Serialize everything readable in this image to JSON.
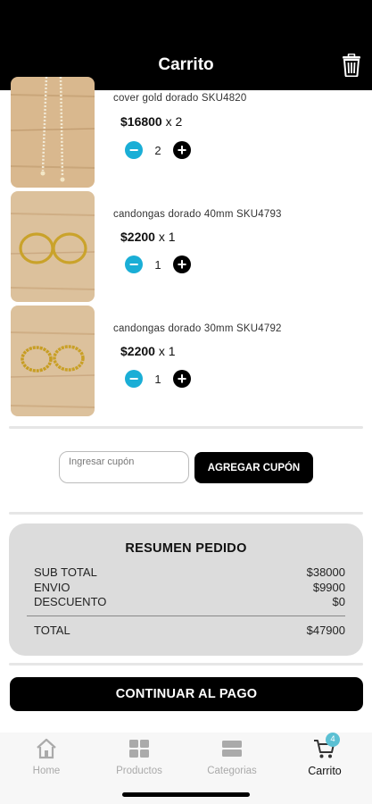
{
  "header": {
    "title": "Carrito",
    "trash_icon": "trash-icon"
  },
  "cart_items": [
    {
      "name": "cover gold dorado   SKU4820",
      "price": "$16800",
      "qty_text": "x 2",
      "quantity": "2"
    },
    {
      "name": "candongas dorado   40mm SKU4793",
      "price": "$2200",
      "qty_text": "x 1",
      "quantity": "1"
    },
    {
      "name": "candongas dorado   30mm SKU4792",
      "price": "$2200",
      "qty_text": "x 1",
      "quantity": "1"
    }
  ],
  "coupon": {
    "placeholder": "Ingresar cupón",
    "button_label": "AGREGAR CUPÓN"
  },
  "summary": {
    "title": "RESUMEN PEDIDO",
    "subtotal_label": "SUB TOTAL",
    "subtotal_value": "$38000",
    "shipping_label": "ENVIO",
    "shipping_value": "$9900",
    "discount_label": "DESCUENTO",
    "discount_value": "$0",
    "total_label": "TOTAL",
    "total_value": "$47900"
  },
  "pay_button": "CONTINUAR AL PAGO",
  "tabs": [
    {
      "label": "Home",
      "icon": "home-icon"
    },
    {
      "label": "Productos",
      "icon": "grid-icon"
    },
    {
      "label": "Categorias",
      "icon": "categories-icon"
    },
    {
      "label": "Carrito",
      "icon": "cart-icon",
      "badge": "4",
      "active": true
    }
  ],
  "colors": {
    "accent": "#1aaed6",
    "badge": "#5bc0d3",
    "header": "#000000",
    "summary_bg": "#dcdcdc"
  }
}
